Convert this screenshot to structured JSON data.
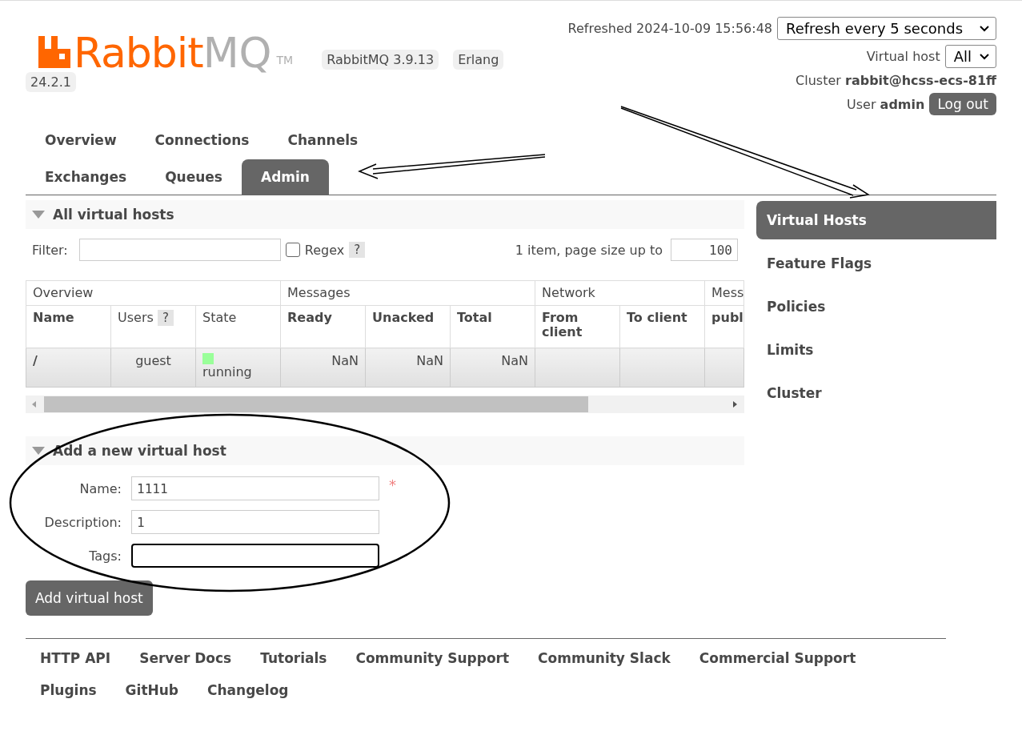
{
  "header": {
    "logo": {
      "brand": "Rabbit",
      "product": "MQ",
      "mark": "TM"
    },
    "badges": [
      "RabbitMQ 3.9.13",
      "Erlang 24.2.1"
    ],
    "refreshed": "Refreshed 2024-10-09 15:56:48",
    "refresh_select": "Refresh every 5 seconds",
    "vhost_label": "Virtual host",
    "vhost_select": "All",
    "cluster": "Cluster **rabbit@hcss-ecs-81ff**",
    "user": "User **admin**",
    "logout": "Log out"
  },
  "tabs": [
    {
      "label": "Overview",
      "selected": false
    },
    {
      "label": "Connections",
      "selected": false
    },
    {
      "label": "Channels",
      "selected": false
    },
    {
      "label": "Exchanges",
      "selected": false
    },
    {
      "label": "Queues",
      "selected": false
    },
    {
      "label": "Admin",
      "selected": true
    }
  ],
  "sidebar": {
    "items": [
      {
        "label": "Virtual Hosts",
        "selected": true
      },
      {
        "label": "Feature Flags",
        "selected": false
      },
      {
        "label": "Policies",
        "selected": false
      },
      {
        "label": "Limits",
        "selected": false
      },
      {
        "label": "Cluster",
        "selected": false
      }
    ]
  },
  "vhosts_section": {
    "title": "All virtual hosts",
    "expanded": true,
    "filter": {
      "label": "Filter:",
      "regex_label": "Regex",
      "regex_checked": false,
      "help": "?"
    },
    "paging": {
      "text": "1 item, page size up to",
      "page_size": "100"
    },
    "table": {
      "groups": [
        {
          "label": "Overview"
        },
        {
          "label": "Messages"
        },
        {
          "label": "Network"
        },
        {
          "label": "Mess"
        }
      ],
      "columns": [
        {
          "label": "Name",
          "sortable": true
        },
        {
          "label": "Users",
          "sortable": false,
          "help": "?"
        },
        {
          "label": "State",
          "sortable": false
        },
        {
          "label": "Ready",
          "sortable": true
        },
        {
          "label": "Unacked",
          "sortable": true
        },
        {
          "label": "Total",
          "sortable": true
        },
        {
          "label": "From client",
          "sortable": true
        },
        {
          "label": "To client",
          "sortable": true
        },
        {
          "label": "publ",
          "sortable": true
        }
      ],
      "rows": [
        {
          "name": "/",
          "users": "guest",
          "state": {
            "label": "running",
            "color": "#99ff99"
          },
          "ready": "NaN",
          "unacked": "NaN",
          "total": "NaN"
        }
      ]
    }
  },
  "add_section": {
    "title": "Add a new virtual host",
    "expanded": true,
    "fields": [
      {
        "label": "Name:",
        "value": "1111",
        "focused": false,
        "required_mark": "*"
      },
      {
        "label": "Description:",
        "value": "1",
        "focused": false
      },
      {
        "label": "Tags:",
        "focused": true
      }
    ],
    "submit": "Add virtual host"
  },
  "footer": {
    "links": [
      "HTTP API",
      "Server Docs",
      "Tutorials",
      "Community Support",
      "Community Slack",
      "Commercial Support",
      "Plugins",
      "GitHub",
      "Changelog"
    ]
  }
}
